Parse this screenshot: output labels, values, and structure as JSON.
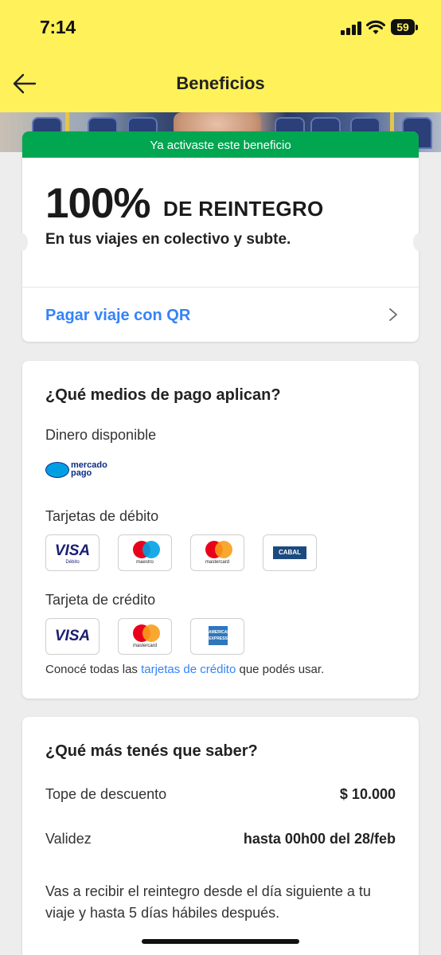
{
  "status_bar": {
    "time": "7:14",
    "battery": "59"
  },
  "nav": {
    "title": "Beneficios",
    "back_icon": "arrow-left-icon"
  },
  "colors": {
    "header": "#fff159",
    "accent": "#3483fa",
    "success": "#00a650",
    "background": "#ededed"
  },
  "benefit": {
    "status_badge": "Ya activaste este beneficio",
    "percent": "100%",
    "percent_label": "DE REINTEGRO",
    "description": "En tus viajes en colectivo y subte.",
    "action": "Pagar viaje con QR"
  },
  "payment_methods": {
    "title": "¿Qué medios de pago aplican?",
    "balance_label": "Dinero disponible",
    "mp_logo": {
      "line1": "mercado",
      "line2": "pago"
    },
    "debit_label": "Tarjetas de débito",
    "debit_cards": [
      {
        "name": "VISA",
        "sub": "Débito"
      },
      {
        "name": "maestro"
      },
      {
        "name": "mastercard"
      },
      {
        "name": "CABAL"
      }
    ],
    "credit_label": "Tarjeta de crédito",
    "credit_cards": [
      {
        "name": "VISA"
      },
      {
        "name": "mastercard"
      },
      {
        "name": "AMERICAN EXPRESS"
      }
    ],
    "note_prefix": "Conocé todas las ",
    "note_link": "tarjetas de crédito",
    "note_suffix": " que podés usar."
  },
  "info": {
    "title": "¿Qué más tenés que saber?",
    "cap_label": "Tope de descuento",
    "cap_value": "$ 10.000",
    "validity_label": "Validez",
    "validity_value": "hasta 00h00 del 28/feb",
    "refund_text": "Vas a recibir el reintegro desde el día siguiente a tu viaje y hasta 5 días hábiles después."
  }
}
